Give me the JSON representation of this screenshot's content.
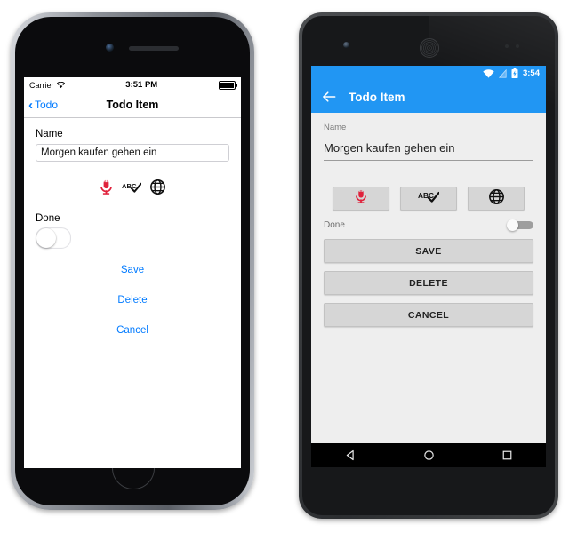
{
  "ios": {
    "status": {
      "carrier": "Carrier",
      "wifi_icon": "wifi-icon",
      "time": "3:51 PM",
      "battery_icon": "battery-icon"
    },
    "navbar": {
      "back_label": "Todo",
      "back_chevron_icon": "chevron-left-icon",
      "title": "Todo Item"
    },
    "form": {
      "name_label": "Name",
      "name_value": "Morgen kaufen gehen ein",
      "name_placeholder": "Name",
      "done_label": "Done",
      "done_checked": false
    },
    "icon_buttons": [
      {
        "name": "microphone-icon",
        "label": "Speech input"
      },
      {
        "name": "abc-check-icon",
        "label": "Spell check"
      },
      {
        "name": "globe-icon",
        "label": "Translate"
      }
    ],
    "actions": [
      {
        "name": "save",
        "label": "Save"
      },
      {
        "name": "delete",
        "label": "Delete"
      },
      {
        "name": "cancel",
        "label": "Cancel"
      }
    ],
    "hardware": {
      "camera": "front-camera",
      "speaker": "earpiece-speaker",
      "home_button": "home-button"
    }
  },
  "android": {
    "status": {
      "wifi_icon": "wifi-icon",
      "signal_icon": "signal-icon",
      "battery_icon": "battery-charging-icon",
      "time": "3:54"
    },
    "appbar": {
      "back_icon": "arrow-back-icon",
      "title": "Todo Item"
    },
    "form": {
      "name_label": "Name",
      "name_words": [
        {
          "text": "Morgen",
          "misspelled": false
        },
        {
          "text": "kaufen",
          "misspelled": true
        },
        {
          "text": "gehen",
          "misspelled": true
        },
        {
          "text": "ein",
          "misspelled": true
        }
      ],
      "done_label": "Done",
      "done_checked": false
    },
    "icon_buttons": [
      {
        "name": "microphone-icon",
        "label": "Speech input"
      },
      {
        "name": "abc-check-icon",
        "label": "Spell check"
      },
      {
        "name": "globe-icon",
        "label": "Translate"
      }
    ],
    "actions": [
      {
        "name": "save",
        "label": "SAVE"
      },
      {
        "name": "delete",
        "label": "DELETE"
      },
      {
        "name": "cancel",
        "label": "CANCEL"
      }
    ],
    "navbar": [
      {
        "name": "back-nav-icon",
        "label": "Back"
      },
      {
        "name": "home-nav-icon",
        "label": "Home"
      },
      {
        "name": "recents-nav-icon",
        "label": "Recents"
      }
    ],
    "hardware": {
      "camera": "front-camera",
      "speaker": "earpiece-speaker",
      "sensors": "proximity-sensors"
    }
  },
  "colors": {
    "ios_tint": "#007AFF",
    "android_primary": "#2196F3",
    "mic_red": "#E0213B",
    "spell_underline": "#FF5252",
    "android_bg": "#EEEEEE",
    "button_grey": "#D6D6D6"
  }
}
